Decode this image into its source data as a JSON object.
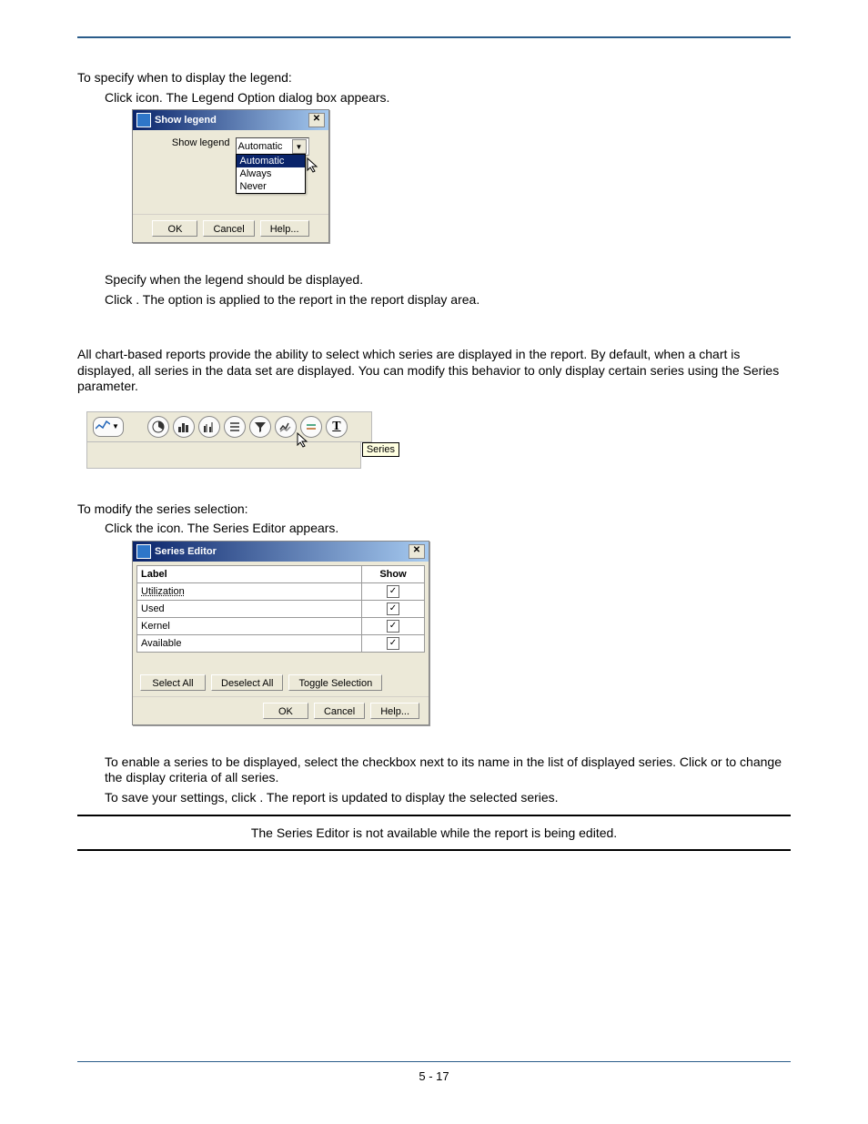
{
  "section1": {
    "intro": "To specify when to display the legend:",
    "step_click_prefix": "Click ",
    "step_click_suffix": " icon. The Legend Option dialog box appears.",
    "step_specify": "Specify when the legend should be displayed.",
    "step_apply_prefix": "Click ",
    "step_apply_suffix": ". The option is applied to the report in the report display area."
  },
  "dialog_legend": {
    "title": "Show legend",
    "label": "Show legend",
    "value": "Automatic",
    "options": [
      "Automatic",
      "Always",
      "Never"
    ],
    "buttons": {
      "ok": "OK",
      "cancel": "Cancel",
      "help": "Help..."
    }
  },
  "section2": {
    "para": "All chart-based reports provide the ability to select which series are displayed in the report. By default, when a chart is displayed, all series in the data set are displayed. You can modify this behavior to only display certain series using the Series parameter.",
    "tooltip": "Series",
    "intro": "To modify the series selection:",
    "step_click_prefix": "Click the ",
    "step_click_suffix": " icon. The Series Editor appears."
  },
  "dialog_series": {
    "title": "Series Editor",
    "columns": {
      "label": "Label",
      "show": "Show"
    },
    "rows": [
      {
        "label": "Utilization",
        "show": true
      },
      {
        "label": "Used",
        "show": true
      },
      {
        "label": "Kernel",
        "show": true
      },
      {
        "label": "Available",
        "show": true
      }
    ],
    "buttons": {
      "select_all": "Select All",
      "deselect_all": "Deselect All",
      "toggle": "Toggle Selection",
      "ok": "OK",
      "cancel": "Cancel",
      "help": "Help..."
    }
  },
  "section3": {
    "p1_a": "To enable a series to be displayed, select the checkbox next to its name in the list of displayed series. Click ",
    "p1_or": " or ",
    "p1_b": " to change the display criteria of all series.",
    "p2_a": "To save your settings, click ",
    "p2_b": ". The report is updated to display the selected series.",
    "note": "The Series Editor is not available while the report is being edited."
  },
  "footer": "5 - 17"
}
